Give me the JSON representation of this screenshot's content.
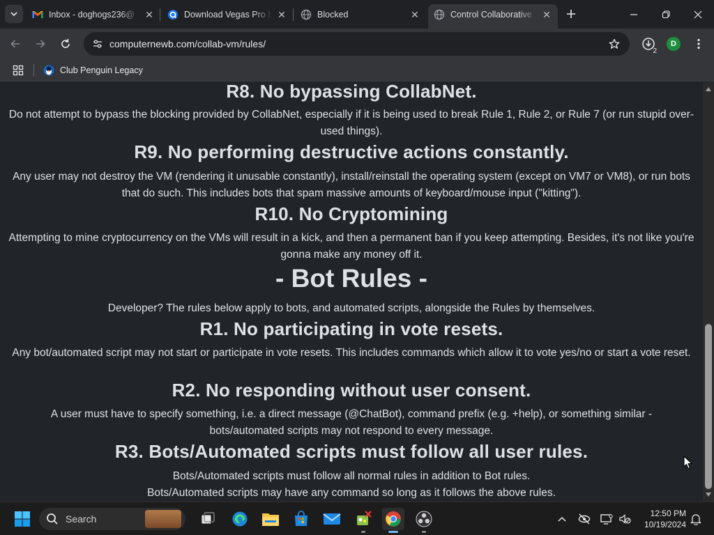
{
  "browser": {
    "tabs": [
      {
        "title": "Inbox - doghogs236@",
        "icon": "gmail-icon",
        "active": false
      },
      {
        "title": "Download Vegas Pro b",
        "icon": "site-q-icon",
        "active": false
      },
      {
        "title": "Blocked",
        "icon": "globe-icon",
        "active": false
      },
      {
        "title": "Control Collaborative",
        "icon": "globe-icon",
        "active": true
      }
    ],
    "address_bar": {
      "url": "computernewb.com/collab-vm/rules/"
    },
    "downloads_count": "2",
    "profile_initial": "D",
    "bookmarks": [
      {
        "label": "Club Penguin Legacy",
        "icon": "club-penguin-icon"
      }
    ]
  },
  "page": {
    "blocks": [
      {
        "kind": "rule_heading",
        "text": "R8. No bypassing CollabNet."
      },
      {
        "kind": "rule_text",
        "text": "Do not attempt to bypass the blocking provided by CollabNet, especially if it is being used to break Rule 1, Rule 2, or Rule 7 (or run stupid over-used things)."
      },
      {
        "kind": "rule_heading",
        "text": "R9. No performing destructive actions constantly."
      },
      {
        "kind": "rule_text",
        "text": "Any user may not destroy the VM (rendering it unusable constantly), install/reinstall the operating system (except on VM7 or VM8), or run bots that do such. This includes bots that spam massive amounts of keyboard/mouse input (\"kitting\")."
      },
      {
        "kind": "rule_heading",
        "text": "R10. No Cryptomining"
      },
      {
        "kind": "rule_text",
        "text": "Attempting to mine cryptocurrency on the VMs will result in a kick, and then a permanent ban if you keep attempting. Besides, it's not like you're gonna make any money off it."
      },
      {
        "kind": "section_heading",
        "text": "- Bot Rules -"
      },
      {
        "kind": "rule_text",
        "text": "Developer? The rules below apply to bots, and automated scripts, alongside the Rules by themselves."
      },
      {
        "kind": "rule_heading",
        "text": "R1. No participating in vote resets."
      },
      {
        "kind": "rule_text",
        "text": "Any bot/automated script may not start or participate in vote resets. This includes commands which allow it to vote yes/no or start a vote reset."
      },
      {
        "kind": "rule_heading",
        "text": "R2. No responding without user consent."
      },
      {
        "kind": "rule_text",
        "text": "A user must have to specify something, i.e. a direct message (@ChatBot), command prefix (e.g. +help), or something similar - bots/automated scripts may not respond to every message."
      },
      {
        "kind": "rule_heading",
        "text": "R3. Bots/Automated scripts must follow all user rules."
      },
      {
        "kind": "rule_text",
        "text": "Bots/Automated scripts must follow all normal rules in addition to Bot rules."
      },
      {
        "kind": "rule_text",
        "text": "Bots/Automated scripts may have any command so long as it follows the above rules."
      }
    ]
  },
  "taskbar": {
    "search_label": "Search",
    "pinned": [
      "start-icon",
      "task-view-icon",
      "edge-icon",
      "file-explorer-icon",
      "microsoft-store-icon",
      "mail-icon",
      "snipping-app-icon",
      "chrome-icon",
      "obs-icon"
    ],
    "clock_time": "12:50 PM",
    "clock_date": "10/19/2024"
  },
  "colors": {
    "page_bg": "#212529",
    "page_text": "#dee2e6",
    "chrome_frame": "#202124",
    "chrome_toolbar": "#35363a",
    "taskbar_bg": "#1c1c1c",
    "accent": "#76b9ed"
  }
}
